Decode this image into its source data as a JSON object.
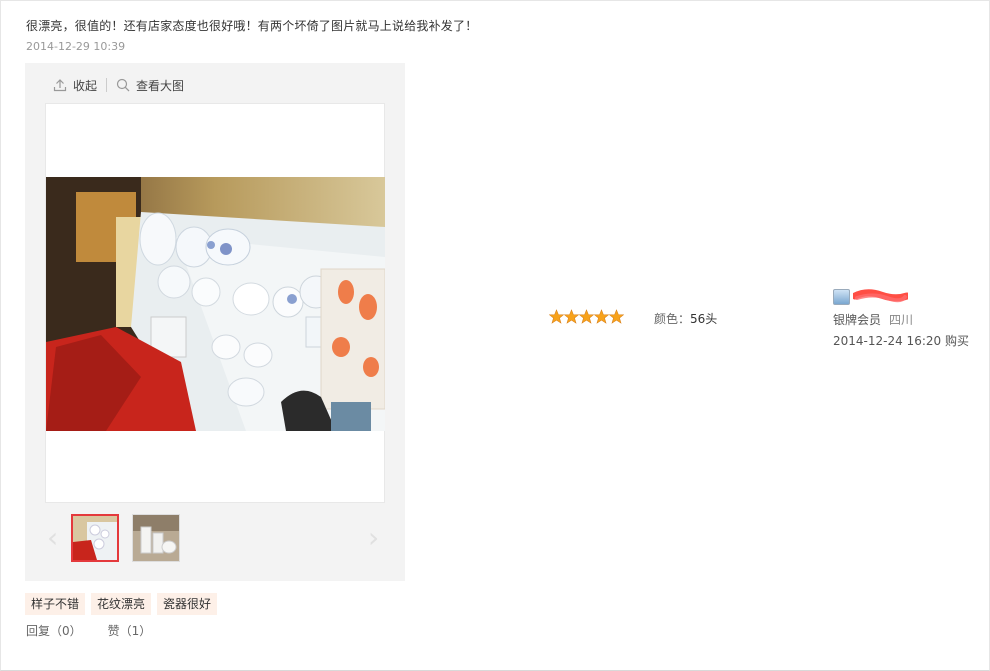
{
  "review": {
    "content": "很漂亮，很值的！还有店家态度也很好哦！有两个坏倚了图片就马上说给我补发了！",
    "date": "2014-12-29 10:39"
  },
  "gallery": {
    "collapse_label": "收起",
    "view_large_label": "查看大图",
    "thumbnails": [
      {
        "name": "dish-set-photo",
        "selected": true
      },
      {
        "name": "cups-photo",
        "selected": false
      }
    ]
  },
  "tags": [
    "样子不错",
    "花纹漂亮",
    "瓷器很好"
  ],
  "actions": {
    "reply": "回复（0）",
    "like": "赞（1）"
  },
  "rating": {
    "stars": 5,
    "max": 5
  },
  "product": {
    "color_label": "颜色：",
    "color_value": "56头"
  },
  "user": {
    "level": "银牌会员",
    "location": "四川",
    "purchase_date": "2014-12-24 16:20 购买"
  },
  "colors": {
    "tag_bg": "#fdf0e8",
    "accent": "#e4393c",
    "star": "#f7a21b"
  }
}
